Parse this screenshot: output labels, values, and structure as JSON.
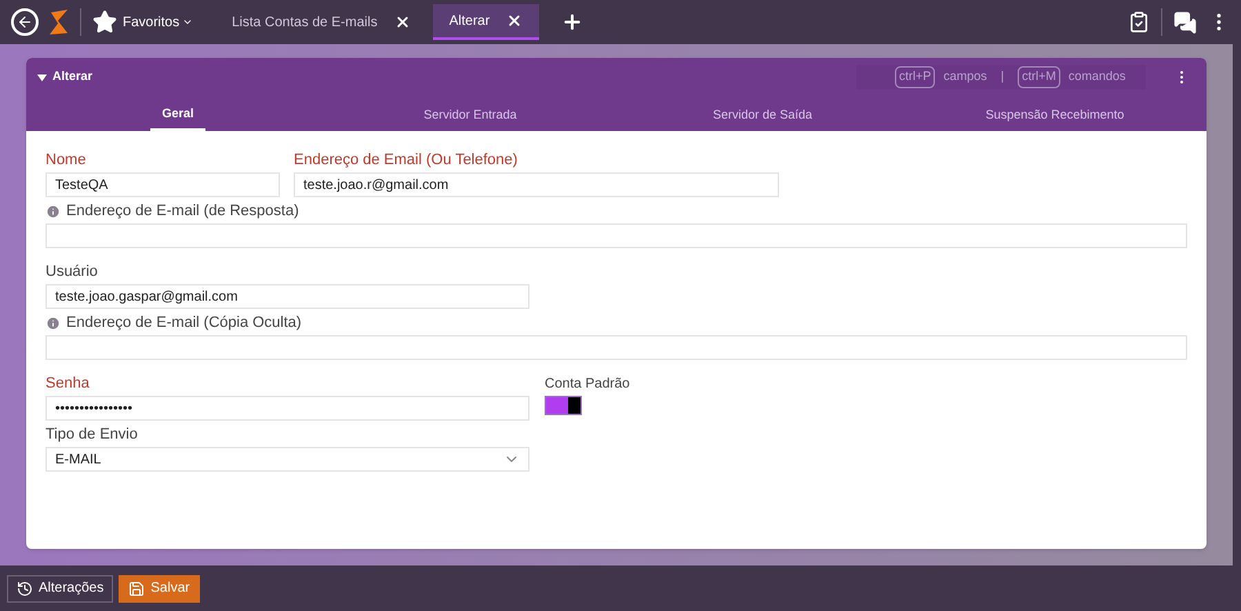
{
  "top_bar": {
    "favorites": "Favoritos",
    "tabs": [
      {
        "label": "Lista Contas de E-mails",
        "selected": false
      },
      {
        "label": "Alterar",
        "selected": true
      }
    ]
  },
  "panel": {
    "title": "Alterar",
    "shortcuts": [
      {
        "key": "ctrl+P",
        "label": "campos"
      },
      {
        "key": "ctrl+M",
        "label": "comandos"
      }
    ],
    "separator": "|",
    "tabs": [
      {
        "label": "Geral",
        "selected": true
      },
      {
        "label": "Servidor Entrada",
        "selected": false
      },
      {
        "label": "Servidor de Saída",
        "selected": false
      },
      {
        "label": "Suspensão Recebimento",
        "selected": false
      }
    ]
  },
  "form": {
    "nome": {
      "label": "Nome",
      "value": "TesteQA",
      "required": true
    },
    "email": {
      "label": "Endereço de Email (Ou Telefone)",
      "value": "teste.joao.r@gmail.com",
      "required": true
    },
    "resposta": {
      "label": "Endereço de E-mail (de Resposta)",
      "info": true,
      "required": false
    },
    "usuario": {
      "label": "Usuário",
      "value": "teste.joao.gaspar@gmail.com",
      "required": false
    },
    "copia": {
      "label": "Endereço de E-mail (Cópia Oculta)",
      "info": true,
      "required": false
    },
    "senha": {
      "label": "Senha",
      "value": "••••••••••••••••",
      "required": true
    },
    "conta_padrao": {
      "label": "Conta Padrão",
      "on": true
    },
    "tipo": {
      "label": "Tipo de Envio",
      "value": "E-MAIL",
      "required": false
    }
  },
  "footer": {
    "buttons": [
      {
        "label": "Alterações",
        "kind": "history"
      },
      {
        "label": "Salvar",
        "kind": "save"
      }
    ]
  }
}
